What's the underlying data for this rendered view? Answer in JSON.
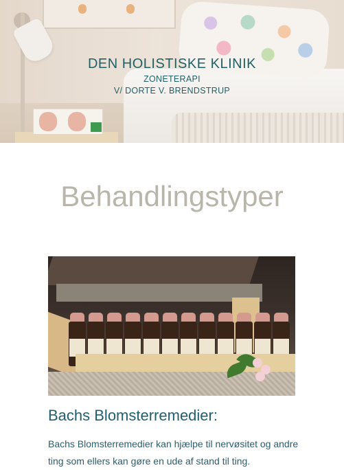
{
  "header": {
    "title": "DEN HOLISTISKE KLINIK",
    "subtitle": "ZONETERAPI",
    "owner": "V/ DORTE V. BRENDSTRUP"
  },
  "main": {
    "heading": "Behandlingstyper",
    "section": {
      "title": "Bachs Blomsterremedier:",
      "body": "Bachs Blomsterremedier kan hjælpe til nervøsitet og andre ting som ellers kan gøre en ude af stand til ting."
    }
  },
  "colors": {
    "brand": "#1f6166",
    "heading": "#b8b6aa",
    "section_title": "#1f5f6f"
  }
}
